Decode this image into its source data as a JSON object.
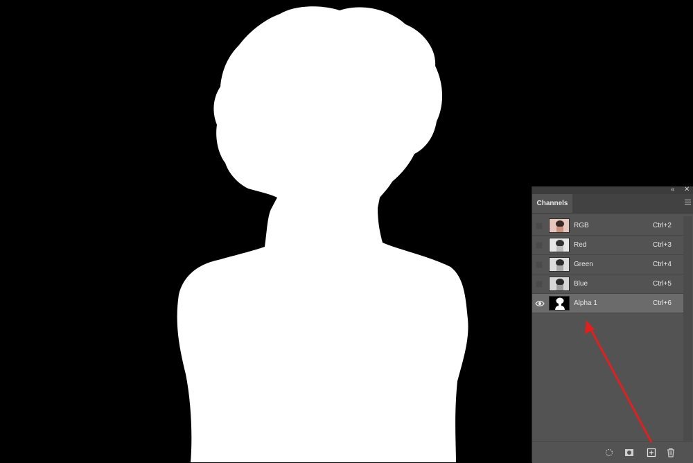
{
  "panel": {
    "tab_label": "Channels",
    "icons": [
      "collapse-icon",
      "close-icon",
      "panel-menu-icon"
    ]
  },
  "channels": [
    {
      "name": "RGB",
      "shortcut": "Ctrl+2",
      "visible": false,
      "selected": false,
      "thumb": "color-portrait"
    },
    {
      "name": "Red",
      "shortcut": "Ctrl+3",
      "visible": false,
      "selected": false,
      "thumb": "gray-portrait"
    },
    {
      "name": "Green",
      "shortcut": "Ctrl+4",
      "visible": false,
      "selected": false,
      "thumb": "gray-portrait"
    },
    {
      "name": "Blue",
      "shortcut": "Ctrl+5",
      "visible": false,
      "selected": false,
      "thumb": "gray-portrait"
    },
    {
      "name": "Alpha 1",
      "shortcut": "Ctrl+6",
      "visible": true,
      "selected": true,
      "thumb": "alpha-mask"
    }
  ],
  "bottom_icons": [
    "load-channel-as-selection-icon",
    "save-selection-as-channel-icon",
    "new-channel-icon",
    "delete-channel-icon"
  ],
  "colors": {
    "canvas": "#000000",
    "mask": "#ffffff",
    "panel": "#535353",
    "annotation_arrow": "#e0201e"
  }
}
